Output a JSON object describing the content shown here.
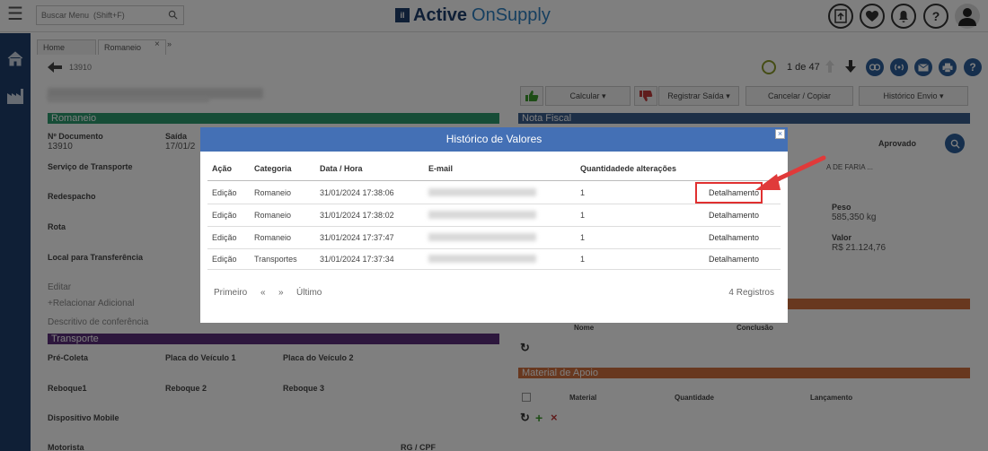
{
  "header": {
    "search_placeholder": "Buscar Menu  (Shift+F)",
    "brand_logo": "il",
    "brand_part1": "Active",
    "brand_part2": "OnSupply",
    "icons": [
      "upload-icon",
      "heart-icon",
      "bell-icon",
      "help-icon",
      "user-icon"
    ],
    "help_label": "?"
  },
  "tabs": [
    {
      "label": "Home"
    },
    {
      "label": "Romaneio"
    }
  ],
  "tab_close": "×",
  "tab_more": "»",
  "record": {
    "doc_number": "13910",
    "pager": "1 de 47",
    "help_label": "?"
  },
  "actions": {
    "calcular": "Calcular ▾",
    "registrar_saida": "Registrar Saída ▾",
    "cancelar_copiar": "Cancelar / Copiar",
    "historico_envio": "Histórico Envio ▾"
  },
  "romaneio": {
    "section_title": "Romaneio",
    "nr_documento_label": "Nº Documento",
    "nr_documento_value": "13910",
    "saida_label": "Saída",
    "saida_value": "17/01/2",
    "servico_label": "Serviço de Transporte",
    "redespacho_label": "Redespacho",
    "rota_label": "Rota",
    "local_label": "Local para Transferência",
    "editar": "Editar",
    "relacionar": "+Relacionar Adicional",
    "descritivo": "Descritivo de conferência"
  },
  "nota_fiscal": {
    "section_title": "Nota Fiscal",
    "aprovado_label": "Aprovado",
    "partial_text": "A DE FARIA ...",
    "peso_label": "Peso",
    "peso_value": "585,350 kg",
    "valor_label": "Valor",
    "valor_value": "R$ 21.124,76"
  },
  "orange_section": {
    "nome_label": "Nome",
    "conclusao_label": "Conclusão"
  },
  "transporte": {
    "section_title": "Transporte",
    "pre_coleta": "Pré-Coleta",
    "placa1": "Placa do Veículo 1",
    "placa2": "Placa do Veículo 2",
    "reboque1": "Reboque1",
    "reboque2": "Reboque 2",
    "reboque3": "Reboque 3",
    "dispositivo": "Dispositivo Mobile",
    "motorista": "Motorista",
    "rg_cpf": "RG / CPF"
  },
  "material_apoio": {
    "section_title": "Material de Apoio",
    "material_label": "Material",
    "quantidade_label": "Quantidade",
    "lancamento_label": "Lançamento"
  },
  "modal": {
    "title": "Histórico de Valores",
    "close": "×",
    "columns": [
      "Ação",
      "Categoria",
      "Data / Hora",
      "E-mail",
      "Quantidadede alterações"
    ],
    "rows": [
      {
        "acao": "Edição",
        "categoria": "Romaneio",
        "data": "31/01/2024 17:38:06",
        "qtd": "1",
        "link": "Detalhamento"
      },
      {
        "acao": "Edição",
        "categoria": "Romaneio",
        "data": "31/01/2024 17:38:02",
        "qtd": "1",
        "link": "Detalhamento"
      },
      {
        "acao": "Edição",
        "categoria": "Romaneio",
        "data": "31/01/2024 17:37:47",
        "qtd": "1",
        "link": "Detalhamento"
      },
      {
        "acao": "Edição",
        "categoria": "Transportes",
        "data": "31/01/2024 17:37:34",
        "qtd": "1",
        "link": "Detalhamento"
      }
    ],
    "pagination": {
      "first": "Primeiro",
      "prev": "«",
      "next": "»",
      "last": "Último"
    },
    "record_count": "4 Registros"
  },
  "colors": {
    "sidebar": "#1e3e6d",
    "modal_header": "#4470b5",
    "romaneio_bar": "#2d9a6f",
    "highlight": "#e03030"
  }
}
